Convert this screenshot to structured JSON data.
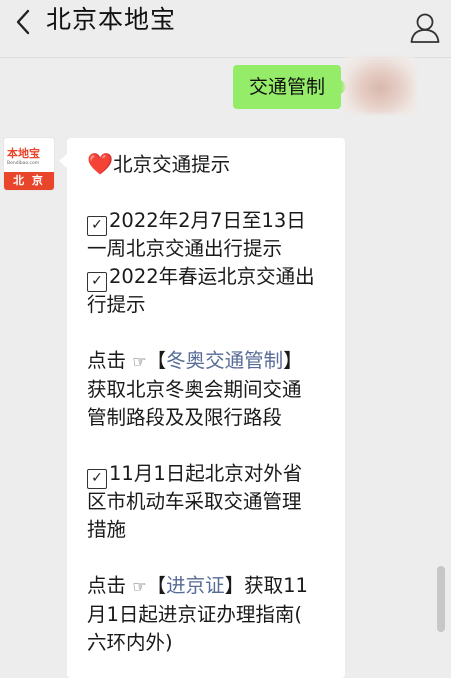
{
  "header": {
    "title": "北京本地宝",
    "back_icon": "chevron-left-icon",
    "profile_icon": "person-icon"
  },
  "outgoing": {
    "text": "交通管制"
  },
  "sender": {
    "logo_text": "本地宝",
    "logo_url": "Bendibao.com",
    "city": "北 京"
  },
  "message": {
    "heading_icon": "❤️",
    "heading": "北京交通提示",
    "check_icon": "☑",
    "item1_line1": "2022年2月7日至13日",
    "item1_line2": "一周北京交通出行提示",
    "item2_line1": "2022年春运北京交通出",
    "item2_line2": "行提示",
    "click_prefix": "点击",
    "hand_icon": "☞",
    "bracket_open": "【",
    "bracket_close": "】",
    "link1": "冬奥交通管制",
    "desc1_line1": "获取北京冬奥会期间交通",
    "desc1_line2": "管制路段及及限行路段",
    "item3_line1": "11月1日起北京对外省",
    "item3_line2": "区市机动车采取交通管理",
    "item3_line3": "措施",
    "link2": "进京证",
    "desc2_suffix": "获取11",
    "desc2_line2": "月1日起进京证办理指南(",
    "desc2_line3": "六环内外)"
  },
  "colors": {
    "background": "#ededed",
    "outgoing_bubble": "#95ec69",
    "link": "#576b95",
    "brand_red": "#e8452a"
  }
}
